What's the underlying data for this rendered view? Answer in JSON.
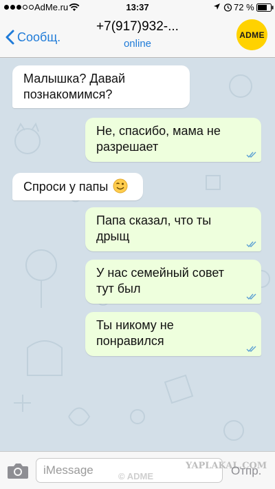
{
  "status_bar": {
    "carrier": "AdMe.ru",
    "time": "13:37",
    "battery_percent": "72 %",
    "battery_level": 0.72,
    "signal_filled": 3,
    "signal_total": 5,
    "icons": [
      "wifi-icon",
      "location-icon",
      "alarm-icon",
      "battery-icon"
    ]
  },
  "nav": {
    "back_label": "Сообщ.",
    "contact": "+7(917)932-...",
    "status": "online",
    "logo_text": "ADME",
    "colors": {
      "accent": "#1f7bd8",
      "logo": "#ffd200"
    }
  },
  "messages": [
    {
      "direction": "in",
      "text": "Малышка? Давай познакомимся?"
    },
    {
      "direction": "out",
      "text": "Не, спасибо, мама не разрешает",
      "read": true
    },
    {
      "direction": "in",
      "text": "Спроси у папы",
      "emoji": "winking-smile-emoji"
    },
    {
      "direction": "out",
      "text": "Папа сказал, что ты дрыщ",
      "read": true
    },
    {
      "direction": "out",
      "text": "У нас семейный совет тут был",
      "read": true
    },
    {
      "direction": "out",
      "text": "Ты никому не понравился",
      "read": true
    }
  ],
  "input": {
    "placeholder": "iMessage",
    "send_label": "Отпр."
  },
  "watermarks": {
    "adme": "© ADME",
    "yaplakal": "YAPLAKAL.COM"
  },
  "colors": {
    "incoming_bubble": "#ffffff",
    "outgoing_bubble": "#eeffdd",
    "chat_background": "#d3dfe8",
    "read_ticks": "#5a9fd4"
  }
}
